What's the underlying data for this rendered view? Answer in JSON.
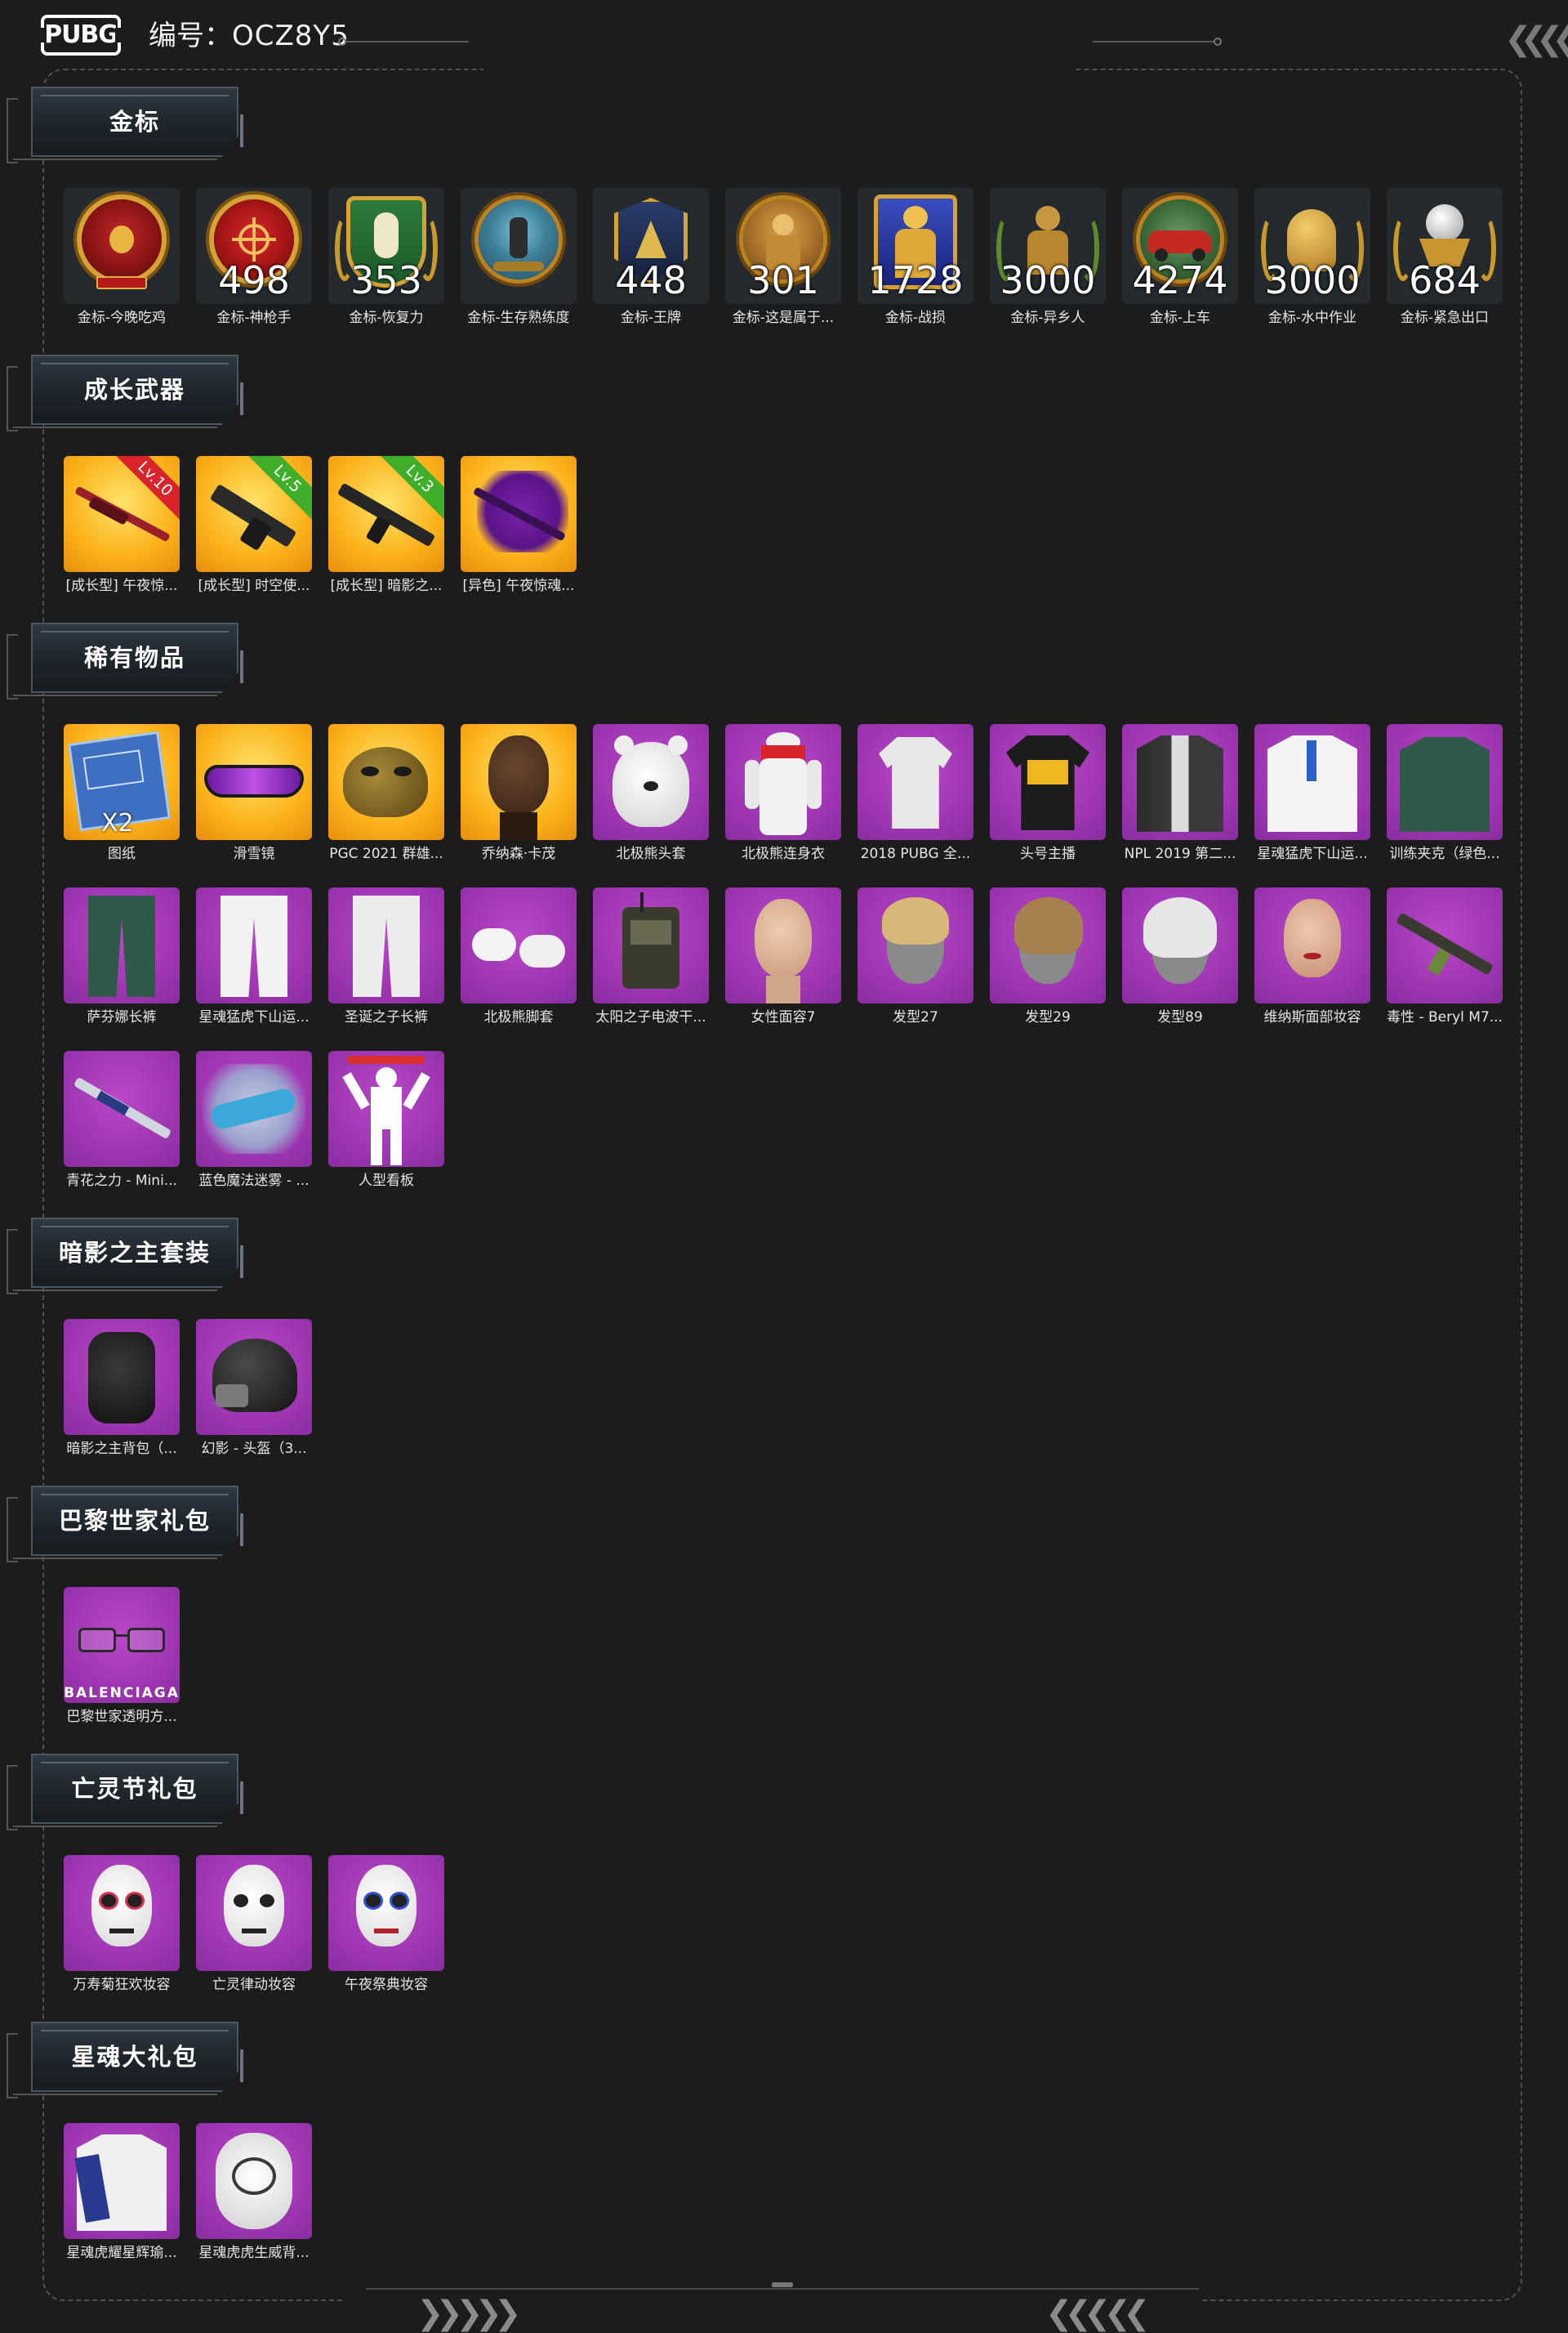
{
  "header": {
    "logo": "PUBG",
    "code_label": "编号：",
    "code_value": "OCZ8Y5"
  },
  "sections": [
    {
      "title": "金标",
      "items": [
        {
          "label": "金标-今晚吃鸡",
          "value": "",
          "icon": "chicken-dinner-badge-icon",
          "tile": "badge"
        },
        {
          "label": "金标-神枪手",
          "value": "498",
          "icon": "crosshair-badge-icon",
          "tile": "badge"
        },
        {
          "label": "金标-恢复力",
          "value": "353",
          "icon": "recovery-badge-icon",
          "tile": "badge"
        },
        {
          "label": "金标-生存熟练度",
          "value": "",
          "icon": "survival-badge-icon",
          "tile": "badge"
        },
        {
          "label": "金标-王牌",
          "value": "448",
          "icon": "ace-badge-icon",
          "tile": "badge"
        },
        {
          "label": "金标-这是属于...",
          "value": "301",
          "icon": "soldier-badge-icon",
          "tile": "badge"
        },
        {
          "label": "金标-战损",
          "value": "1728",
          "icon": "battle-damage-badge-icon",
          "tile": "badge"
        },
        {
          "label": "金标-异乡人",
          "value": "3000",
          "icon": "stranger-badge-icon",
          "tile": "badge"
        },
        {
          "label": "金标-上车",
          "value": "4274",
          "icon": "car-badge-icon",
          "tile": "badge"
        },
        {
          "label": "金标-水中作业",
          "value": "3000",
          "icon": "seal-badge-icon",
          "tile": "badge"
        },
        {
          "label": "金标-紧急出口",
          "value": "684",
          "icon": "emergency-exit-badge-icon",
          "tile": "badge"
        }
      ]
    },
    {
      "title": "成长武器",
      "items": [
        {
          "label": "[成长型] 午夜惊...",
          "level": "Lv.10",
          "level_color": "red",
          "icon": "rifle-red-icon",
          "tile": "gold"
        },
        {
          "label": "[成长型] 时空使...",
          "level": "Lv.5",
          "level_color": "green",
          "icon": "smg-icon",
          "tile": "gold"
        },
        {
          "label": "[成长型] 暗影之...",
          "level": "Lv.3",
          "level_color": "green",
          "icon": "assault-rifle-icon",
          "tile": "gold"
        },
        {
          "label": "[异色] 午夜惊魂...",
          "level": "",
          "level_color": "",
          "icon": "purple-rifle-icon",
          "tile": "gold"
        }
      ]
    },
    {
      "title": "稀有物品",
      "items": [
        {
          "label": "图纸",
          "qty": "X2",
          "icon": "blueprint-icon",
          "tile": "gold"
        },
        {
          "label": "滑雪镜",
          "icon": "ski-goggles-icon",
          "tile": "gold"
        },
        {
          "label": "PGC 2021 群雄...",
          "icon": "gold-mask-icon",
          "tile": "gold"
        },
        {
          "label": "乔纳森·卡茂",
          "icon": "face-icon",
          "tile": "gold"
        },
        {
          "label": "北极熊头套",
          "icon": "polar-bear-head-icon",
          "tile": "purple"
        },
        {
          "label": "北极熊连身衣",
          "icon": "bear-suit-icon",
          "tile": "purple"
        },
        {
          "label": "2018 PUBG 全...",
          "icon": "tshirt-icon",
          "tile": "purple"
        },
        {
          "label": "头号主播",
          "icon": "black-tshirt-icon",
          "tile": "purple"
        },
        {
          "label": "NPL 2019 第二...",
          "icon": "jacket-icon",
          "tile": "purple"
        },
        {
          "label": "星魂猛虎下山运...",
          "icon": "white-jacket-icon",
          "tile": "purple"
        },
        {
          "label": "训练夹克（绿色...",
          "icon": "green-jacket-icon",
          "tile": "purple"
        },
        {
          "label": "萨芬娜长裤",
          "icon": "green-pants-icon",
          "tile": "purple"
        },
        {
          "label": "星魂猛虎下山运...",
          "icon": "white-pants-icon",
          "tile": "purple"
        },
        {
          "label": "圣诞之子长裤",
          "icon": "white-pants-2-icon",
          "tile": "purple"
        },
        {
          "label": "北极熊脚套",
          "icon": "bear-feet-icon",
          "tile": "purple"
        },
        {
          "label": "太阳之子电波干...",
          "icon": "backpack-radio-icon",
          "tile": "purple"
        },
        {
          "label": "女性面容7",
          "icon": "female-face-icon",
          "tile": "purple"
        },
        {
          "label": "发型27",
          "icon": "hairstyle-27-icon",
          "tile": "purple"
        },
        {
          "label": "发型29",
          "icon": "hairstyle-29-icon",
          "tile": "purple"
        },
        {
          "label": "发型89",
          "icon": "hairstyle-89-icon",
          "tile": "purple"
        },
        {
          "label": "维纳斯面部妆容",
          "icon": "makeup-face-icon",
          "tile": "purple"
        },
        {
          "label": "毒性 - Beryl M7...",
          "icon": "beryl-rifle-icon",
          "tile": "purple"
        },
        {
          "label": "青花之力 - Mini...",
          "icon": "mini14-rifle-icon",
          "tile": "purple"
        },
        {
          "label": "蓝色魔法迷雾 - ...",
          "icon": "magic-mist-icon",
          "tile": "purple"
        },
        {
          "label": "人型看板",
          "icon": "human-board-icon",
          "tile": "purple"
        }
      ]
    },
    {
      "title": "暗影之主套装",
      "items": [
        {
          "label": "暗影之主背包（...",
          "icon": "shadow-backpack-icon",
          "tile": "purple"
        },
        {
          "label": "幻影 - 头盔（3...",
          "icon": "helmet-icon",
          "tile": "purple"
        }
      ]
    },
    {
      "title": "巴黎世家礼包",
      "items": [
        {
          "label": "巴黎世家透明方...",
          "brand": "BALENCIAGA",
          "icon": "glasses-icon",
          "tile": "purple"
        }
      ]
    },
    {
      "title": "亡灵节礼包",
      "items": [
        {
          "label": "万寿菊狂欢妆容",
          "icon": "skull-makeup-icon",
          "tile": "purple"
        },
        {
          "label": "亡灵律动妆容",
          "icon": "skull-makeup-2-icon",
          "tile": "purple"
        },
        {
          "label": "午夜祭典妆容",
          "icon": "skull-makeup-3-icon",
          "tile": "purple"
        }
      ]
    },
    {
      "title": "星魂大礼包",
      "items": [
        {
          "label": "星魂虎耀星辉瑜...",
          "icon": "star-jacket-icon",
          "tile": "purple"
        },
        {
          "label": "星魂虎虎生威背...",
          "icon": "tiger-backpack-icon",
          "tile": "purple"
        }
      ]
    }
  ]
}
